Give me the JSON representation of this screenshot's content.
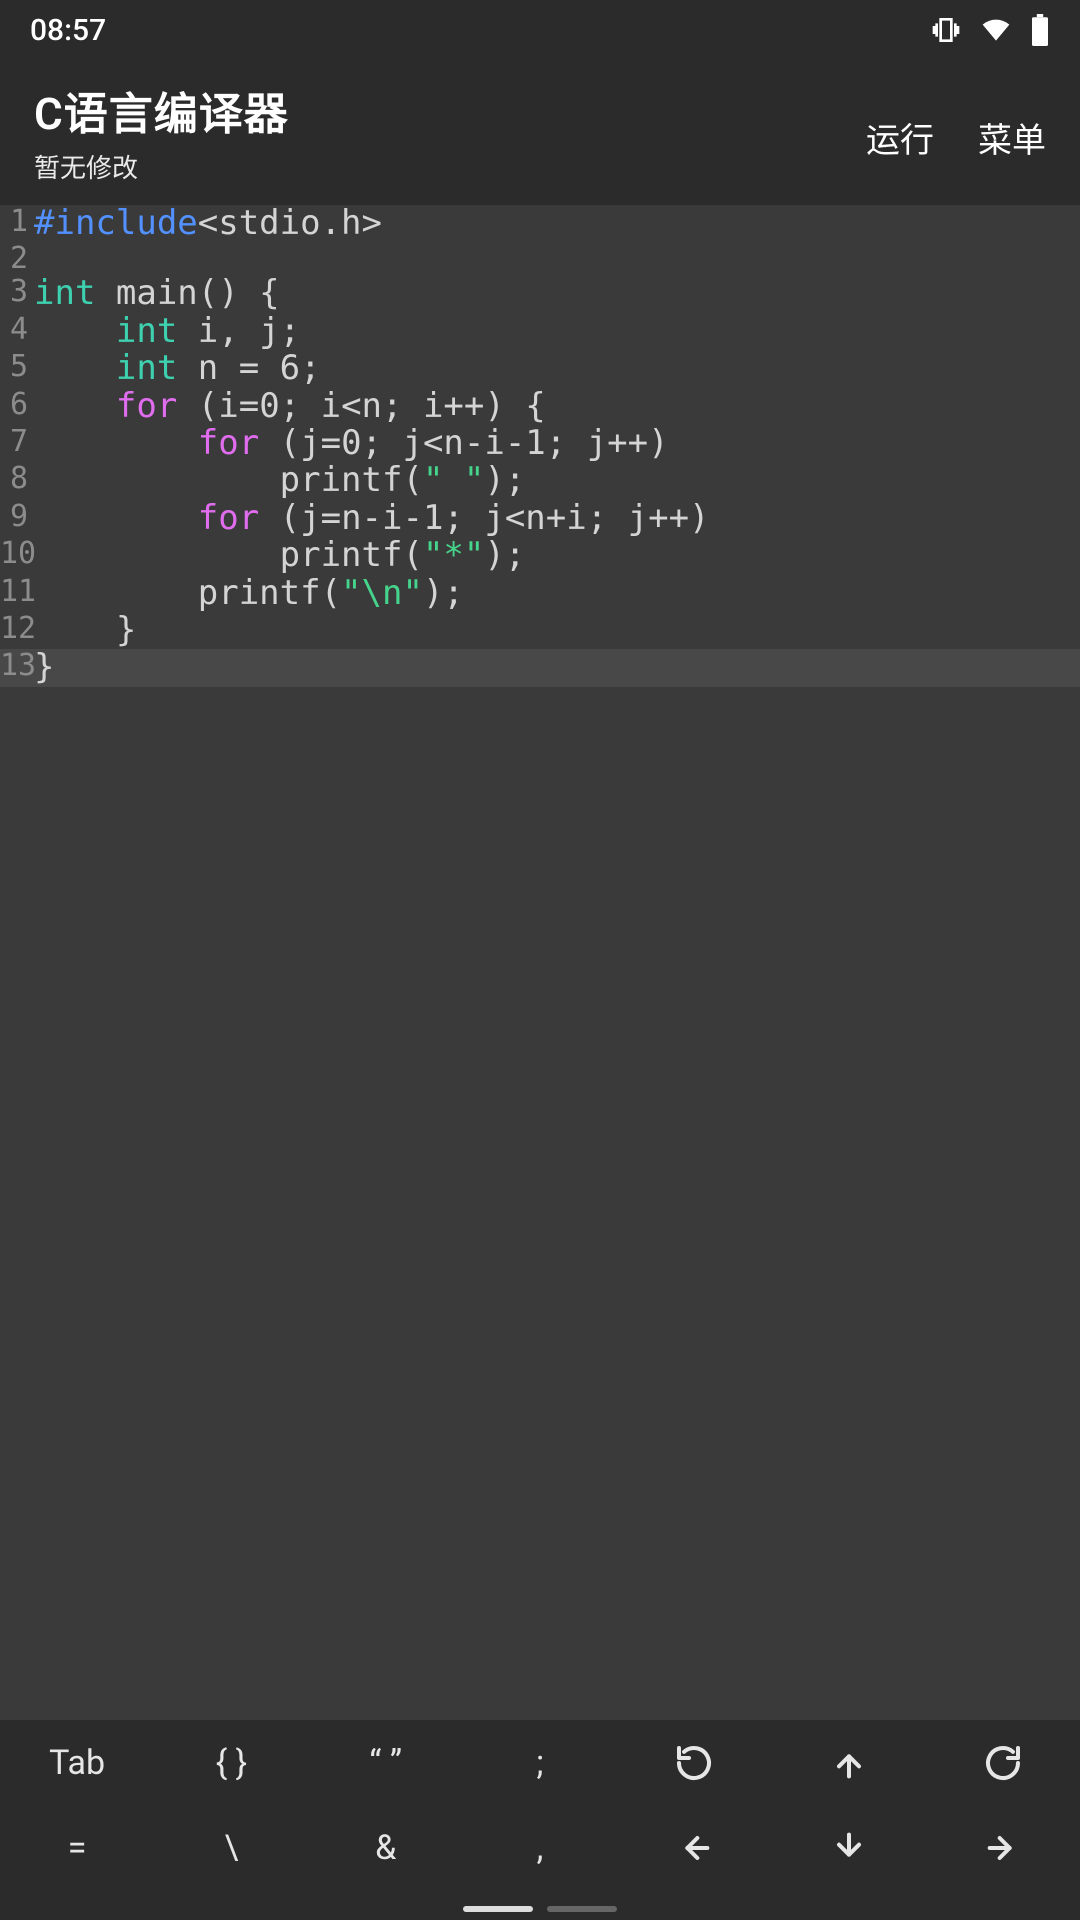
{
  "status": {
    "time": "08:57"
  },
  "header": {
    "title": "C语言编译器",
    "subtitle": "暂无修改",
    "run_label": "运行",
    "menu_label": "菜单"
  },
  "editor": {
    "current_line": 13,
    "lines": [
      {
        "n": 1,
        "tokens": [
          [
            "pp",
            "#include"
          ],
          [
            "txt",
            "<stdio.h>"
          ]
        ]
      },
      {
        "n": 2,
        "tokens": [
          [
            "txt",
            ""
          ]
        ]
      },
      {
        "n": 3,
        "tokens": [
          [
            "kw",
            "int"
          ],
          [
            "txt",
            " main() {"
          ]
        ]
      },
      {
        "n": 4,
        "tokens": [
          [
            "txt",
            "    "
          ],
          [
            "kw",
            "int"
          ],
          [
            "txt",
            " i, j;"
          ]
        ]
      },
      {
        "n": 5,
        "tokens": [
          [
            "txt",
            "    "
          ],
          [
            "kw",
            "int"
          ],
          [
            "txt",
            " n = 6;"
          ]
        ]
      },
      {
        "n": 6,
        "tokens": [
          [
            "txt",
            "    "
          ],
          [
            "ctrl",
            "for"
          ],
          [
            "txt",
            " (i=0; i<n; i++) {"
          ]
        ]
      },
      {
        "n": 7,
        "tokens": [
          [
            "txt",
            "        "
          ],
          [
            "ctrl",
            "for"
          ],
          [
            "txt",
            " (j=0; j<n-i-1; j++)"
          ]
        ]
      },
      {
        "n": 8,
        "tokens": [
          [
            "txt",
            "            printf("
          ],
          [
            "str",
            "\" \""
          ],
          [
            "txt",
            ");"
          ]
        ]
      },
      {
        "n": 9,
        "tokens": [
          [
            "txt",
            "        "
          ],
          [
            "ctrl",
            "for"
          ],
          [
            "txt",
            " (j=n-i-1; j<n+i; j++)"
          ]
        ]
      },
      {
        "n": 10,
        "tokens": [
          [
            "txt",
            "            printf("
          ],
          [
            "str",
            "\"*\""
          ],
          [
            "txt",
            ");"
          ]
        ]
      },
      {
        "n": 11,
        "tokens": [
          [
            "txt",
            "        printf("
          ],
          [
            "str",
            "\"\\n\""
          ],
          [
            "txt",
            ");"
          ]
        ]
      },
      {
        "n": 12,
        "tokens": [
          [
            "txt",
            "    }"
          ]
        ]
      },
      {
        "n": 13,
        "tokens": [
          [
            "txt",
            "}"
          ]
        ]
      }
    ]
  },
  "keybar": {
    "row1": [
      {
        "type": "text",
        "label": "Tab",
        "name": "tab-key"
      },
      {
        "type": "text",
        "label": "{ }",
        "name": "braces-key"
      },
      {
        "type": "text",
        "label": "“ ”",
        "name": "quotes-key"
      },
      {
        "type": "text",
        "label": ";",
        "name": "semicolon-key"
      },
      {
        "type": "icon",
        "icon": "undo",
        "name": "undo-key"
      },
      {
        "type": "icon",
        "icon": "up",
        "name": "up-key"
      },
      {
        "type": "icon",
        "icon": "redo",
        "name": "redo-key"
      }
    ],
    "row2": [
      {
        "type": "text",
        "label": "=",
        "name": "equals-key"
      },
      {
        "type": "text",
        "label": "\\",
        "name": "backslash-key"
      },
      {
        "type": "text",
        "label": "&",
        "name": "ampersand-key"
      },
      {
        "type": "text",
        "label": ",",
        "name": "comma-key"
      },
      {
        "type": "icon",
        "icon": "left",
        "name": "left-key"
      },
      {
        "type": "icon",
        "icon": "down",
        "name": "down-key"
      },
      {
        "type": "icon",
        "icon": "right",
        "name": "right-key"
      }
    ]
  }
}
